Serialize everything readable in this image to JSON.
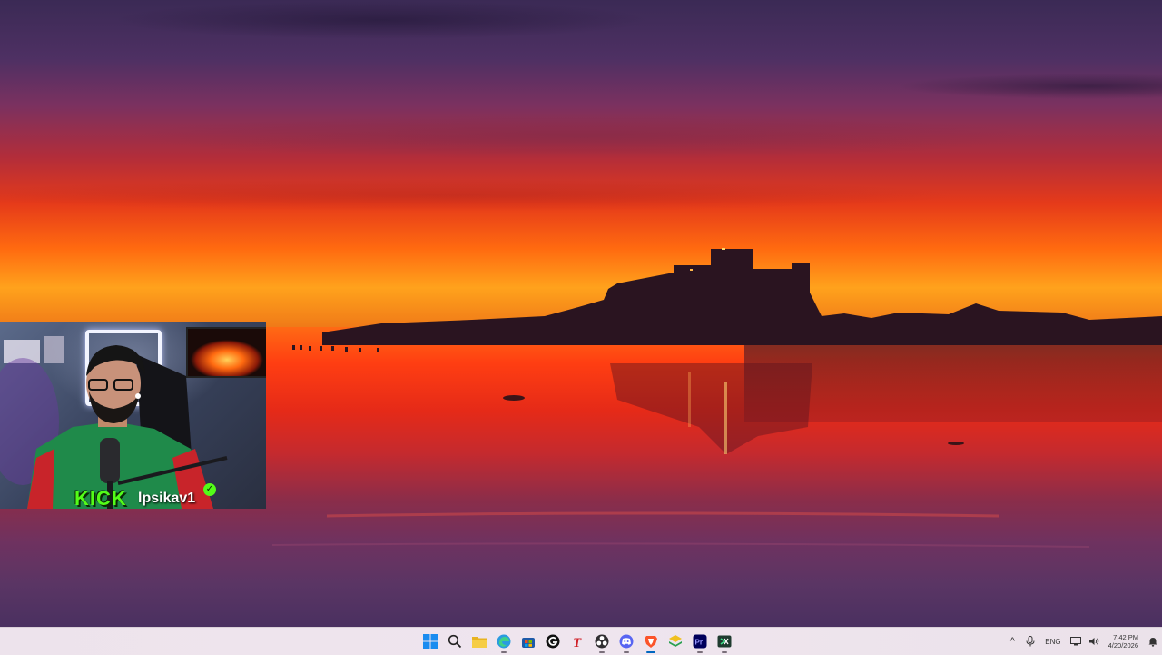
{
  "webcam": {
    "platform": "KICK",
    "username": "lpsikav1"
  },
  "taskbar": {
    "apps": [
      {
        "name": "start",
        "active": false
      },
      {
        "name": "search",
        "active": false
      },
      {
        "name": "file-explorer",
        "active": false
      },
      {
        "name": "edge",
        "active": true
      },
      {
        "name": "store",
        "active": false
      },
      {
        "name": "g-hub",
        "active": false
      },
      {
        "name": "typora",
        "active": false
      },
      {
        "name": "obs",
        "active": true
      },
      {
        "name": "discord",
        "active": true
      },
      {
        "name": "brave",
        "active": true
      },
      {
        "name": "layers",
        "active": false
      },
      {
        "name": "premiere-pro",
        "active": true
      },
      {
        "name": "terminal",
        "active": true
      }
    ],
    "tray": {
      "language": "ENG",
      "time": "7:42 PM",
      "date": "4/20/2026"
    }
  },
  "colors": {
    "kick_green": "#53fc18",
    "taskbar_bg": "#efe5ee",
    "accent": "#0067c0"
  }
}
